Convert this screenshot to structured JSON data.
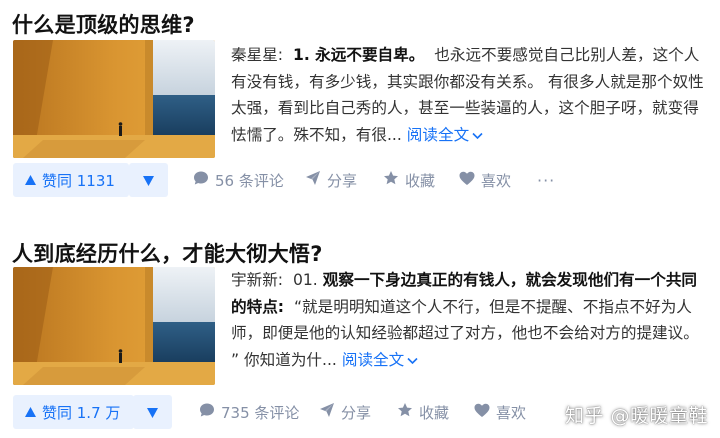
{
  "answers": [
    {
      "title": "什么是顶级的思维?",
      "author": "秦星星:",
      "lead": "1. 永远不要自卑。",
      "body": "也永远不要感觉自己比别人差，这个人有没有钱，有多少钱，其实跟你都没有关系。 有很多人就是那个奴性太强，看到比自己秀的人，甚至一些装逼的人，这个胆子呀，就变得怯懦了。殊不知，有很...",
      "read_more": "阅读全文",
      "vote_label": "赞同 1131",
      "comments": "56 条评论",
      "share": "分享",
      "favorite": "收藏",
      "like": "喜欢",
      "more": "···"
    },
    {
      "title": "人到底经历什么，才能大彻大悟?",
      "author": "宇新新:",
      "lead_prefix": "01.",
      "lead": "观察一下身边真正的有钱人，就会发现他们有一个共同的特点:",
      "body": "“就是明明知道这个人不行，但是不提醒、不指点不好为人师，即便是他的认知经验都超过了对方，他也不会给对方的提建议。 ” 你知道为什...",
      "read_more": "阅读全文",
      "vote_label": "赞同 1.7 万",
      "comments": "735 条评论",
      "share": "分享",
      "favorite": "收藏",
      "like": "喜欢"
    }
  ],
  "watermark": "知乎 @暖暖童鞋",
  "icons": {
    "vote_up": "triangle-up-icon",
    "vote_down": "triangle-down-icon",
    "comment": "comment-bubble-icon",
    "share": "paper-plane-icon",
    "favorite": "star-icon",
    "like": "heart-icon",
    "more": "ellipsis-icon"
  },
  "colors": {
    "accent": "#1772f6",
    "vote_bg": "#e9f1fe",
    "muted": "#8590a6",
    "title": "#121212",
    "text": "#333333"
  }
}
